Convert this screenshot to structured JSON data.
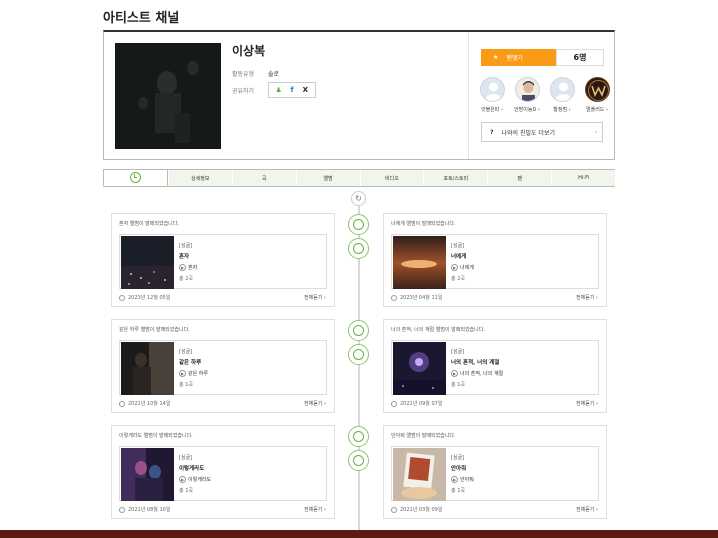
{
  "header": {
    "title": "아티스트 채널"
  },
  "artist": {
    "name": "이상복",
    "activity_label": "활동유형",
    "activity_value": "솔로",
    "share_label": "공유하기"
  },
  "fan_panel": {
    "fan_button_label": "팬맺기",
    "fan_count": "6명",
    "fans": [
      {
        "name": "앗볼은따 ›"
      },
      {
        "name": "안방이뇽D ›"
      },
      {
        "name": "황정범 ›"
      },
      {
        "name": "멀플러드 ›"
      }
    ],
    "intimacy_q": "?",
    "intimacy_label": "나와의 친밀도 더보기",
    "intimacy_chevron": "›"
  },
  "tabs": [
    "",
    "상세정보",
    "곡",
    "앨범",
    "비디오",
    "포토/스토리",
    "팬",
    "Hi-Fi"
  ],
  "timeline": {
    "refresh_icon": "↻",
    "all_label": "전체듣기 ›",
    "cards": [
      {
        "head": "혼자 앨범이 발매되었습니다.",
        "type": "[싱글]",
        "title": "혼자",
        "track": "혼자",
        "count": "총 2곡",
        "date": "2023년 12월 05일"
      },
      {
        "head": "너에게 앨범이 발매되었습니다.",
        "type": "[싱글]",
        "title": "너에게",
        "track": "너에게",
        "count": "총 2곡",
        "date": "2023년 04월 11일"
      },
      {
        "head": "같은 하루 앨범이 발매되었습니다.",
        "type": "[싱글]",
        "title": "같은 하루",
        "track": "같은 하루",
        "count": "총 1곡",
        "date": "2021년 10월 14일"
      },
      {
        "head": "너의 흔적, 너의 계절 앨범이 발매되었습니다.",
        "type": "[싱글]",
        "title": "너의 흔적, 너의 계절",
        "track": "너의 흔적, 너의 계절",
        "count": "총 1곡",
        "date": "2021년 09월 07일"
      },
      {
        "head": "이렇게라도 앨범이 발매되었습니다.",
        "type": "[싱글]",
        "title": "이렇게라도",
        "track": "이렇게라도",
        "count": "총 1곡",
        "date": "2021년 08월 10일"
      },
      {
        "head": "안아줘 앨범이 발매되었습니다.",
        "type": "[싱글]",
        "title": "안아줘",
        "track": "안아줘",
        "count": "총 1곡",
        "date": "2021년 03월 09일"
      }
    ]
  },
  "colors": {
    "accent_green": "#64b53c",
    "fan_orange": "#fa9b16",
    "tab_bg": "#f0f6ec"
  }
}
